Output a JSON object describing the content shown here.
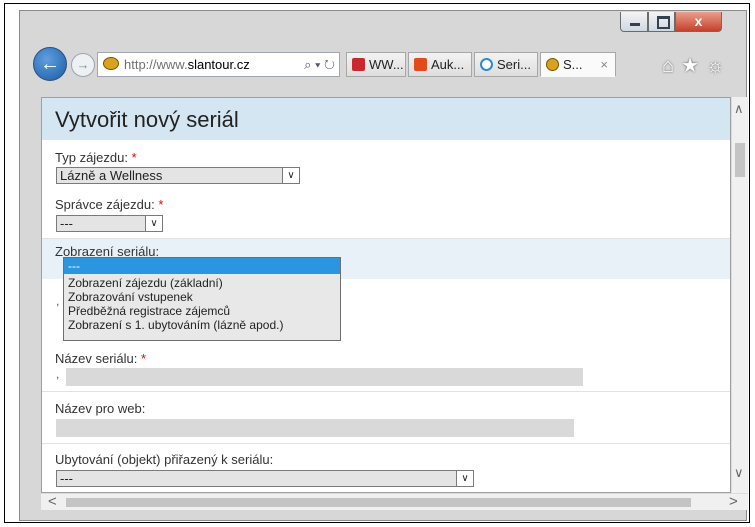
{
  "browser": {
    "back_icon": "back-arrow-icon",
    "forward_icon": "forward-arrow-icon",
    "address_prefix": "http://www.",
    "address_domain": "slantour.cz",
    "address_tools": "⌕ ▾ ↻",
    "tabs": [
      {
        "label": "WW...",
        "icon": "ti-red",
        "active": false
      },
      {
        "label": "Auk...",
        "icon": "ti-orange",
        "active": false
      },
      {
        "label": "Seri...",
        "icon": "ti-ie",
        "active": false
      },
      {
        "label": "S...",
        "icon": "ti-ie2",
        "active": true
      }
    ],
    "tab_close": "×",
    "right_icons": "⌂★☼",
    "close_glyph": "x"
  },
  "page": {
    "title": "Vytvořit nový seriál",
    "required_marker": "*",
    "typ_label": "Typ zájezdu:",
    "typ_value": "Lázně a Wellness",
    "spravce_label": "Správce zájezdu:",
    "spravce_value": "---",
    "zobrazeni_label": "Zobrazení seriálu:",
    "zobrazeni_options": [
      "---",
      "Zobrazení zájezdu (základní)",
      "Zobrazování vstupenek",
      "Předběžná registrace zájemců",
      "Zobrazení s 1. ubytováním (lázně apod.)"
    ],
    "zobrazeni_selected_index": 0,
    "nazev_label": "Název seriálu:",
    "nazev_web_label": "Název pro web:",
    "ubytovani_label": "Ubytování (objekt) přiřazený k seriálu:",
    "ubytovani_value": "---",
    "stray_comma": ","
  },
  "colors": {
    "title_band": "#d4e6f2",
    "highlight_band": "#e8f1f8",
    "selection": "#2b95df",
    "required": "#ee0000"
  }
}
